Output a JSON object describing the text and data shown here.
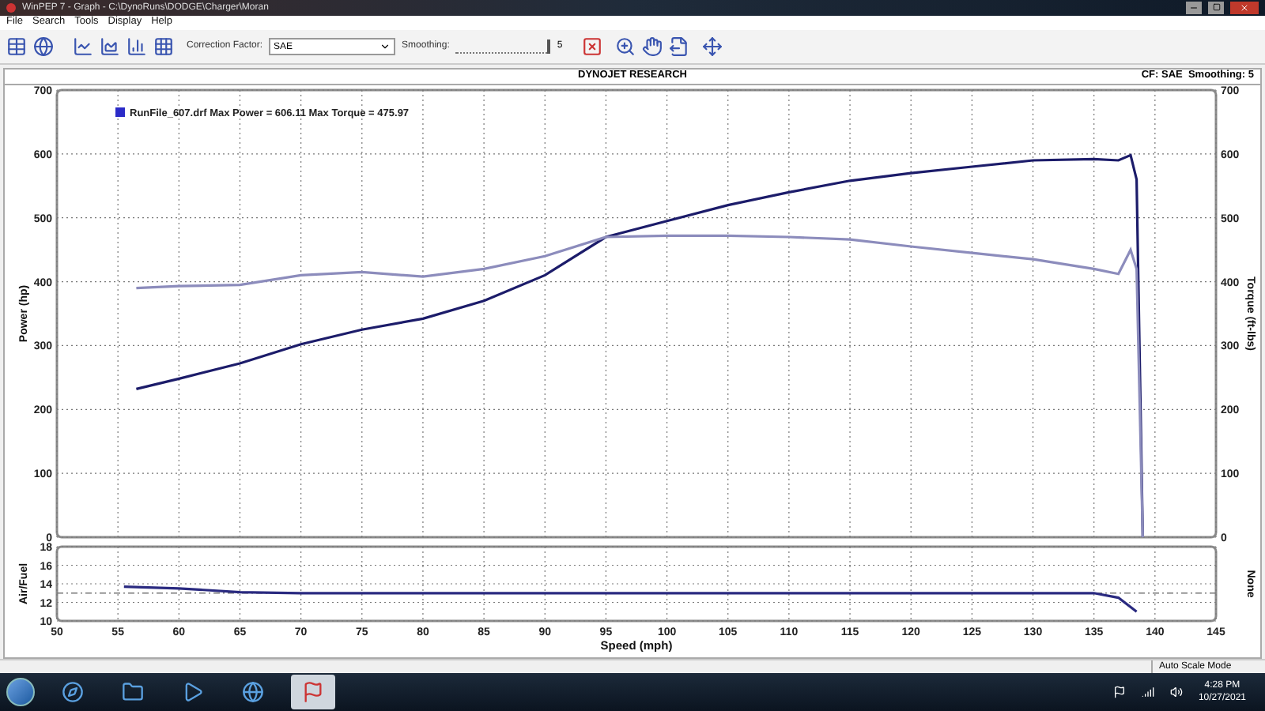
{
  "window": {
    "title": "WinPEP 7 - Graph - C:\\DynoRuns\\DODGE\\Charger\\Moran"
  },
  "menu": [
    "File",
    "Search",
    "Tools",
    "Display",
    "Help"
  ],
  "toolbar": {
    "correction_label": "Correction Factor:",
    "correction_value": "SAE",
    "smoothing_label": "Smoothing:",
    "smoothing": {
      "level": 1,
      "reading": "5"
    }
  },
  "graph": {
    "title": "DYNOJET RESEARCH",
    "info": "CF: SAE  Smoothing: 5",
    "legend": {
      "label": "RunFile_607.drf Max Power = 606.11 Max Torque = 475.97",
      "color": "#2b2bc8"
    },
    "main_chart": {
      "chart_data": {
        "type": "line",
        "grid": true,
        "ylabel": "Power (hp)",
        "y2label": "Torque (ft-lbs)",
        "xlim": [
          50,
          145
        ],
        "ylim": [
          0,
          700
        ],
        "yticks": [
          0,
          100,
          200,
          300,
          400,
          500,
          600,
          700
        ],
        "y2lim": [
          0,
          700
        ],
        "y2ticks": [
          0,
          100,
          200,
          300,
          400,
          500,
          600,
          700
        ],
        "x": [
          56.5,
          60,
          65,
          70,
          75,
          80,
          85,
          90,
          95,
          100,
          105,
          110,
          115,
          120,
          125,
          130,
          135,
          137,
          138,
          138.5,
          139
        ],
        "series": [
          {
            "color": "#1c1c6a",
            "values": [
              232,
              248,
              272,
              302,
              325,
              342,
              370,
              410,
              470,
              495,
              520,
              540,
              558,
              570,
              580,
              590,
              592,
              590,
              598,
              560,
              0
            ]
          },
          {
            "color": "#8c8cbc",
            "values": [
              390,
              393,
              395,
              410,
              415,
              408,
              420,
              440,
              470,
              472,
              472,
              470,
              466,
              455,
              445,
              435,
              420,
              412,
              450,
              420,
              0
            ]
          }
        ]
      }
    },
    "af_chart": {
      "chart_data": {
        "type": "line",
        "grid": true,
        "xlabel": "Speed (mph)",
        "ylabel": "Air/Fuel",
        "y2label": "None",
        "xlim": [
          50,
          145
        ],
        "ylim": [
          10,
          18
        ],
        "xticks": [
          50,
          55,
          60,
          65,
          70,
          75,
          80,
          85,
          90,
          95,
          100,
          105,
          110,
          115,
          120,
          125,
          130,
          135,
          140,
          145
        ],
        "yticks": [
          10,
          12,
          14,
          16,
          18
        ],
        "ref_lines": [
          {
            "axis": "y",
            "value": 13
          }
        ],
        "x": [
          55.5,
          60,
          65,
          70,
          80,
          100,
          120,
          135,
          137,
          138.5
        ],
        "series": [
          {
            "color": "#2a2a80",
            "values": [
              13.7,
              13.5,
              13.1,
              13.0,
              13.0,
              13.0,
              13.0,
              13.0,
              12.5,
              11.0
            ]
          }
        ]
      }
    }
  },
  "status_bar": "Auto Scale Mode",
  "taskbar": {
    "apps": [
      {
        "kind": "browser",
        "selected": false
      },
      {
        "kind": "folder",
        "selected": false
      },
      {
        "kind": "media",
        "selected": false
      },
      {
        "kind": "edge",
        "selected": false
      },
      {
        "kind": "dyno",
        "selected": true
      }
    ],
    "time": "4:28 PM",
    "date": "10/27/2021"
  }
}
